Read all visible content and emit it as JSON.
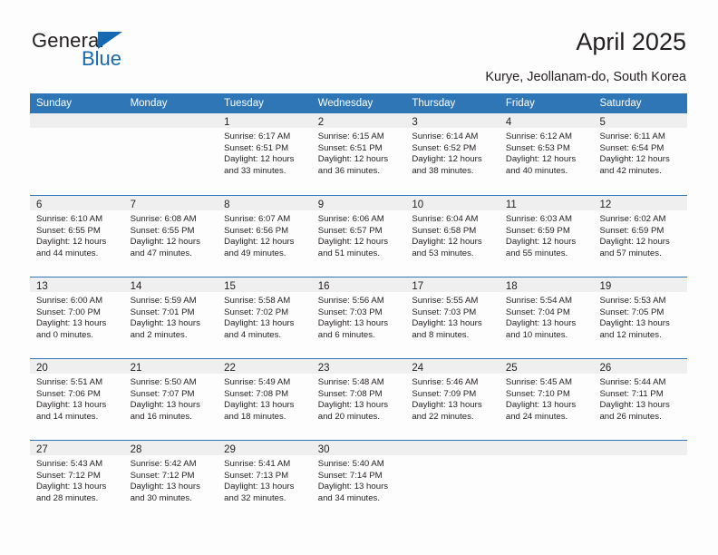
{
  "brand": {
    "name_part1": "General",
    "name_part2": "Blue",
    "logo_icon": "triangle-logo-icon",
    "accent_color": "#1469b0"
  },
  "header": {
    "title": "April 2025",
    "location": "Kurye, Jeollanam-do, South Korea"
  },
  "theme": {
    "header_bg": "#2f76b7",
    "daynum_band_bg": "#efefef",
    "separator": "#2f76b7",
    "text": "#231f20",
    "page_bg": "#fdfdfd"
  },
  "calendar": {
    "weekday_headers": [
      "Sunday",
      "Monday",
      "Tuesday",
      "Wednesday",
      "Thursday",
      "Friday",
      "Saturday"
    ],
    "weeks": [
      [
        {
          "day": "",
          "empty": true,
          "sunrise": "",
          "sunset": "",
          "daylight1": "",
          "daylight2": ""
        },
        {
          "day": "",
          "empty": true,
          "sunrise": "",
          "sunset": "",
          "daylight1": "",
          "daylight2": ""
        },
        {
          "day": "1",
          "empty": false,
          "sunrise": "Sunrise: 6:17 AM",
          "sunset": "Sunset: 6:51 PM",
          "daylight1": "Daylight: 12 hours",
          "daylight2": "and 33 minutes."
        },
        {
          "day": "2",
          "empty": false,
          "sunrise": "Sunrise: 6:15 AM",
          "sunset": "Sunset: 6:51 PM",
          "daylight1": "Daylight: 12 hours",
          "daylight2": "and 36 minutes."
        },
        {
          "day": "3",
          "empty": false,
          "sunrise": "Sunrise: 6:14 AM",
          "sunset": "Sunset: 6:52 PM",
          "daylight1": "Daylight: 12 hours",
          "daylight2": "and 38 minutes."
        },
        {
          "day": "4",
          "empty": false,
          "sunrise": "Sunrise: 6:12 AM",
          "sunset": "Sunset: 6:53 PM",
          "daylight1": "Daylight: 12 hours",
          "daylight2": "and 40 minutes."
        },
        {
          "day": "5",
          "empty": false,
          "sunrise": "Sunrise: 6:11 AM",
          "sunset": "Sunset: 6:54 PM",
          "daylight1": "Daylight: 12 hours",
          "daylight2": "and 42 minutes."
        }
      ],
      [
        {
          "day": "6",
          "empty": false,
          "sunrise": "Sunrise: 6:10 AM",
          "sunset": "Sunset: 6:55 PM",
          "daylight1": "Daylight: 12 hours",
          "daylight2": "and 44 minutes."
        },
        {
          "day": "7",
          "empty": false,
          "sunrise": "Sunrise: 6:08 AM",
          "sunset": "Sunset: 6:55 PM",
          "daylight1": "Daylight: 12 hours",
          "daylight2": "and 47 minutes."
        },
        {
          "day": "8",
          "empty": false,
          "sunrise": "Sunrise: 6:07 AM",
          "sunset": "Sunset: 6:56 PM",
          "daylight1": "Daylight: 12 hours",
          "daylight2": "and 49 minutes."
        },
        {
          "day": "9",
          "empty": false,
          "sunrise": "Sunrise: 6:06 AM",
          "sunset": "Sunset: 6:57 PM",
          "daylight1": "Daylight: 12 hours",
          "daylight2": "and 51 minutes."
        },
        {
          "day": "10",
          "empty": false,
          "sunrise": "Sunrise: 6:04 AM",
          "sunset": "Sunset: 6:58 PM",
          "daylight1": "Daylight: 12 hours",
          "daylight2": "and 53 minutes."
        },
        {
          "day": "11",
          "empty": false,
          "sunrise": "Sunrise: 6:03 AM",
          "sunset": "Sunset: 6:59 PM",
          "daylight1": "Daylight: 12 hours",
          "daylight2": "and 55 minutes."
        },
        {
          "day": "12",
          "empty": false,
          "sunrise": "Sunrise: 6:02 AM",
          "sunset": "Sunset: 6:59 PM",
          "daylight1": "Daylight: 12 hours",
          "daylight2": "and 57 minutes."
        }
      ],
      [
        {
          "day": "13",
          "empty": false,
          "sunrise": "Sunrise: 6:00 AM",
          "sunset": "Sunset: 7:00 PM",
          "daylight1": "Daylight: 13 hours",
          "daylight2": "and 0 minutes."
        },
        {
          "day": "14",
          "empty": false,
          "sunrise": "Sunrise: 5:59 AM",
          "sunset": "Sunset: 7:01 PM",
          "daylight1": "Daylight: 13 hours",
          "daylight2": "and 2 minutes."
        },
        {
          "day": "15",
          "empty": false,
          "sunrise": "Sunrise: 5:58 AM",
          "sunset": "Sunset: 7:02 PM",
          "daylight1": "Daylight: 13 hours",
          "daylight2": "and 4 minutes."
        },
        {
          "day": "16",
          "empty": false,
          "sunrise": "Sunrise: 5:56 AM",
          "sunset": "Sunset: 7:03 PM",
          "daylight1": "Daylight: 13 hours",
          "daylight2": "and 6 minutes."
        },
        {
          "day": "17",
          "empty": false,
          "sunrise": "Sunrise: 5:55 AM",
          "sunset": "Sunset: 7:03 PM",
          "daylight1": "Daylight: 13 hours",
          "daylight2": "and 8 minutes."
        },
        {
          "day": "18",
          "empty": false,
          "sunrise": "Sunrise: 5:54 AM",
          "sunset": "Sunset: 7:04 PM",
          "daylight1": "Daylight: 13 hours",
          "daylight2": "and 10 minutes."
        },
        {
          "day": "19",
          "empty": false,
          "sunrise": "Sunrise: 5:53 AM",
          "sunset": "Sunset: 7:05 PM",
          "daylight1": "Daylight: 13 hours",
          "daylight2": "and 12 minutes."
        }
      ],
      [
        {
          "day": "20",
          "empty": false,
          "sunrise": "Sunrise: 5:51 AM",
          "sunset": "Sunset: 7:06 PM",
          "daylight1": "Daylight: 13 hours",
          "daylight2": "and 14 minutes."
        },
        {
          "day": "21",
          "empty": false,
          "sunrise": "Sunrise: 5:50 AM",
          "sunset": "Sunset: 7:07 PM",
          "daylight1": "Daylight: 13 hours",
          "daylight2": "and 16 minutes."
        },
        {
          "day": "22",
          "empty": false,
          "sunrise": "Sunrise: 5:49 AM",
          "sunset": "Sunset: 7:08 PM",
          "daylight1": "Daylight: 13 hours",
          "daylight2": "and 18 minutes."
        },
        {
          "day": "23",
          "empty": false,
          "sunrise": "Sunrise: 5:48 AM",
          "sunset": "Sunset: 7:08 PM",
          "daylight1": "Daylight: 13 hours",
          "daylight2": "and 20 minutes."
        },
        {
          "day": "24",
          "empty": false,
          "sunrise": "Sunrise: 5:46 AM",
          "sunset": "Sunset: 7:09 PM",
          "daylight1": "Daylight: 13 hours",
          "daylight2": "and 22 minutes."
        },
        {
          "day": "25",
          "empty": false,
          "sunrise": "Sunrise: 5:45 AM",
          "sunset": "Sunset: 7:10 PM",
          "daylight1": "Daylight: 13 hours",
          "daylight2": "and 24 minutes."
        },
        {
          "day": "26",
          "empty": false,
          "sunrise": "Sunrise: 5:44 AM",
          "sunset": "Sunset: 7:11 PM",
          "daylight1": "Daylight: 13 hours",
          "daylight2": "and 26 minutes."
        }
      ],
      [
        {
          "day": "27",
          "empty": false,
          "sunrise": "Sunrise: 5:43 AM",
          "sunset": "Sunset: 7:12 PM",
          "daylight1": "Daylight: 13 hours",
          "daylight2": "and 28 minutes."
        },
        {
          "day": "28",
          "empty": false,
          "sunrise": "Sunrise: 5:42 AM",
          "sunset": "Sunset: 7:12 PM",
          "daylight1": "Daylight: 13 hours",
          "daylight2": "and 30 minutes."
        },
        {
          "day": "29",
          "empty": false,
          "sunrise": "Sunrise: 5:41 AM",
          "sunset": "Sunset: 7:13 PM",
          "daylight1": "Daylight: 13 hours",
          "daylight2": "and 32 minutes."
        },
        {
          "day": "30",
          "empty": false,
          "sunrise": "Sunrise: 5:40 AM",
          "sunset": "Sunset: 7:14 PM",
          "daylight1": "Daylight: 13 hours",
          "daylight2": "and 34 minutes."
        },
        {
          "day": "",
          "empty": true,
          "sunrise": "",
          "sunset": "",
          "daylight1": "",
          "daylight2": ""
        },
        {
          "day": "",
          "empty": true,
          "sunrise": "",
          "sunset": "",
          "daylight1": "",
          "daylight2": ""
        },
        {
          "day": "",
          "empty": true,
          "sunrise": "",
          "sunset": "",
          "daylight1": "",
          "daylight2": ""
        }
      ]
    ]
  }
}
